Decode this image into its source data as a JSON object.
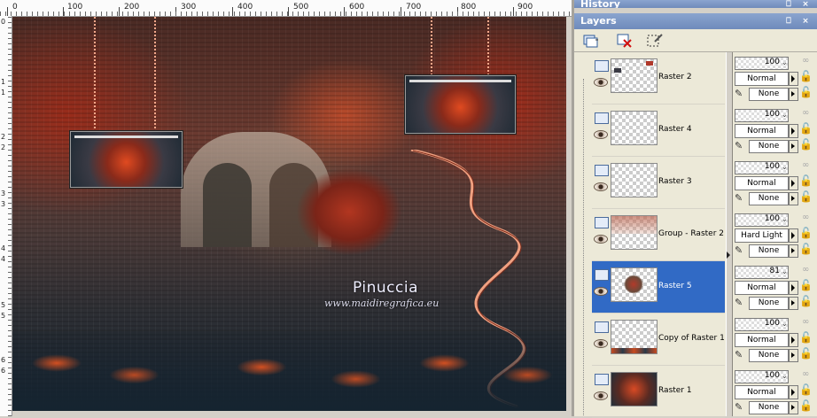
{
  "ruler": {
    "top_labels": [
      "0",
      "100",
      "200",
      "300",
      "400",
      "500",
      "600",
      "700",
      "800",
      "900"
    ],
    "left_labels": [
      "0",
      "1",
      "1",
      "2",
      "2",
      "3",
      "3",
      "4",
      "4",
      "5",
      "5",
      "6",
      "6"
    ]
  },
  "canvas": {
    "watermark": "Pinuccia",
    "watermark_url": "www.maidiregrafica.eu"
  },
  "panels": {
    "history_title": "History",
    "layers_title": "Layers",
    "pin_glyph": "⎕",
    "close_glyph": "×"
  },
  "layers": [
    {
      "name": "Raster 2",
      "opacity": "100",
      "blend": "Normal",
      "mask": "None",
      "selected": false
    },
    {
      "name": "Raster 4",
      "opacity": "100",
      "blend": "Normal",
      "mask": "None",
      "selected": false
    },
    {
      "name": "Raster 3",
      "opacity": "100",
      "blend": "Normal",
      "mask": "None",
      "selected": false
    },
    {
      "name": "Group - Raster 2",
      "opacity": "100",
      "blend": "Hard Light",
      "mask": "None",
      "selected": false
    },
    {
      "name": "Raster 5",
      "opacity": "81",
      "blend": "Normal",
      "mask": "None",
      "selected": true
    },
    {
      "name": "Copy of Raster 1",
      "opacity": "100",
      "blend": "Normal",
      "mask": "None",
      "selected": false
    },
    {
      "name": "Raster 1",
      "opacity": "100",
      "blend": "Normal",
      "mask": "None",
      "selected": false
    }
  ],
  "icons": {
    "visibility": "layer-visibility-icon",
    "eye": "eye-icon",
    "lock": "lock-icon",
    "brush": "brush-icon",
    "new_layer": "new-layer-icon",
    "delete_layer": "delete-layer-icon",
    "edit_selection": "edit-selection-icon"
  },
  "colors": {
    "selection": "#316ac5",
    "title_bar": "#7892c2",
    "panel_bg": "#ece9d8"
  }
}
